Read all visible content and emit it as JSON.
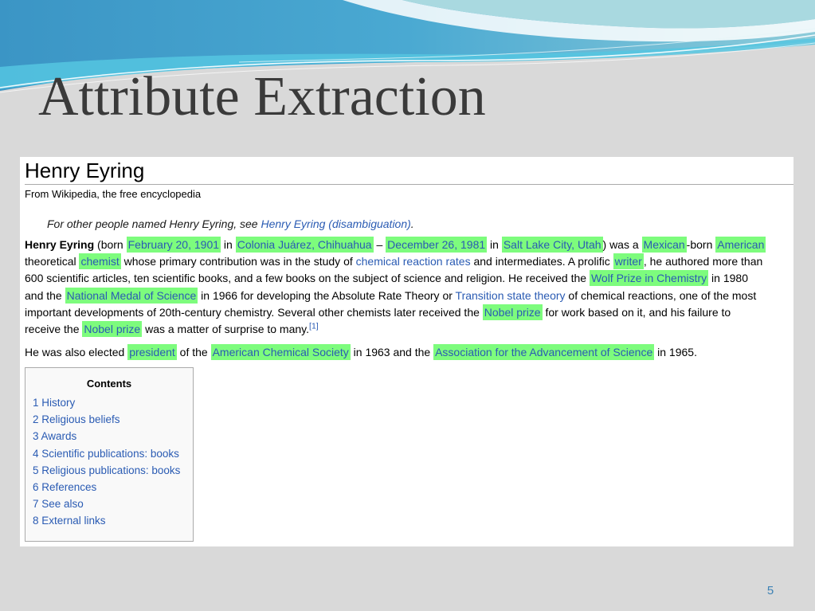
{
  "slide": {
    "title": "Attribute Extraction",
    "page_number": "5"
  },
  "article": {
    "heading": "Henry Eyring",
    "site_sub": "From Wikipedia, the free encyclopedia",
    "hatnote": {
      "prefix": "For other people named Henry Eyring, see ",
      "link": "Henry Eyring (disambiguation)",
      "suffix": "."
    },
    "paragraphs": [
      {
        "lines": [
          [
            {
              "text": "Henry Eyring",
              "bold": true
            },
            {
              "text": " (born "
            },
            {
              "text": "February 20, 1901",
              "link": true,
              "highlighted": true
            },
            {
              "text": " in "
            },
            {
              "text": "Colonia Juárez, Chihuahua",
              "link": true,
              "highlighted": true
            },
            {
              "text": " – "
            },
            {
              "text": "December 26, 1981",
              "link": true,
              "highlighted": true
            },
            {
              "text": " in "
            },
            {
              "text": "Salt Lake City, Utah",
              "link": true,
              "highlighted": true
            },
            {
              "text": ") was a "
            },
            {
              "text": "Mexican",
              "link": true,
              "highlighted": true
            },
            {
              "text": "-born "
            },
            {
              "text": "American",
              "link": true,
              "highlighted": true
            }
          ],
          [
            {
              "text": "theoretical "
            },
            {
              "text": "chemist",
              "link": true,
              "highlighted": true
            },
            {
              "text": " whose primary contribution was in the study of "
            },
            {
              "text": "chemical reaction rates",
              "link": true
            },
            {
              "text": " and intermediates. A prolific "
            },
            {
              "text": "writer",
              "link": true,
              "highlighted": true
            },
            {
              "text": ", he authored more than"
            }
          ],
          [
            {
              "text": "600 scientific articles, ten scientific books, and a few books on the subject of science and religion. He received the "
            },
            {
              "text": "Wolf Prize in Chemistry",
              "link": true,
              "highlighted": true
            },
            {
              "text": " in 1980"
            }
          ],
          [
            {
              "text": "and the "
            },
            {
              "text": "National Medal of Science",
              "link": true,
              "highlighted": true
            },
            {
              "text": " in 1966 for developing the Absolute Rate Theory or "
            },
            {
              "text": "Transition state theory",
              "link": true
            },
            {
              "text": " of chemical reactions, one of the most"
            }
          ],
          [
            {
              "text": "important developments of 20th-century chemistry. Several other chemists later received the "
            },
            {
              "text": "Nobel prize",
              "link": true,
              "highlighted": true
            },
            {
              "text": " for work based on it, and his failure to"
            }
          ],
          [
            {
              "text": "receive the "
            },
            {
              "text": "Nobel prize",
              "link": true,
              "highlighted": true
            },
            {
              "text": " was a matter of surprise to many."
            },
            {
              "text": "[1]",
              "link": true,
              "superscript": true
            }
          ]
        ]
      },
      {
        "lines": [
          [
            {
              "text": "He was also elected "
            },
            {
              "text": "president",
              "link": true,
              "highlighted": true
            },
            {
              "text": " of the "
            },
            {
              "text": "American Chemical Society",
              "link": true,
              "highlighted": true
            },
            {
              "text": " in 1963 and the "
            },
            {
              "text": "Association for the Advancement of Science",
              "link": true,
              "highlighted": true
            },
            {
              "text": " in 1965."
            }
          ]
        ]
      }
    ],
    "contents": {
      "title": "Contents",
      "items": [
        "1 History",
        "2 Religious beliefs",
        "3 Awards",
        "4 Scientific publications: books",
        "5 Religious publications: books",
        "6 References",
        "7 See also",
        "8 External links"
      ]
    }
  },
  "colors": {
    "background": "#d9d9d9",
    "title": "#3a3a3a",
    "link": "#2a5bb3",
    "highlight": "#7dfc7d",
    "page_number": "#3d82b5",
    "wave_dark": "#3b95c5",
    "wave_mid": "#4aa9d2",
    "wave_light": "#8ccbd9",
    "wave_band": "#55c6e1",
    "wave_top": "#a9d9e0"
  }
}
